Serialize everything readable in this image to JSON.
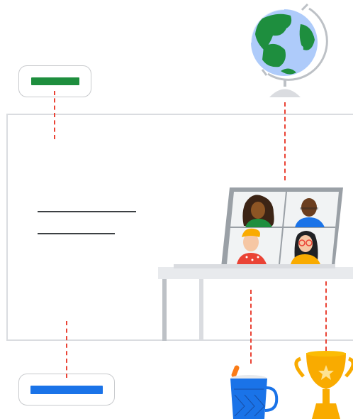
{
  "colors": {
    "frame_border": "#dadce0",
    "pill_bar_top": "#1e8e3e",
    "pill_bar_bottom": "#1a73e8",
    "dashed_connector": "#ea4335",
    "text_lines": "#3c4043",
    "globe_ocean": "#aecbfa",
    "globe_land": "#1e8e3e",
    "mug": "#1a73e8",
    "trophy": "#f9ab00",
    "laptop_body": "#9aa0a6",
    "desk": "#e8eaed"
  },
  "icons": {
    "globe": "globe-icon",
    "laptop": "laptop-video-call-icon",
    "mug": "mug-icon",
    "trophy": "trophy-icon"
  },
  "video_call": {
    "participants": 4
  }
}
